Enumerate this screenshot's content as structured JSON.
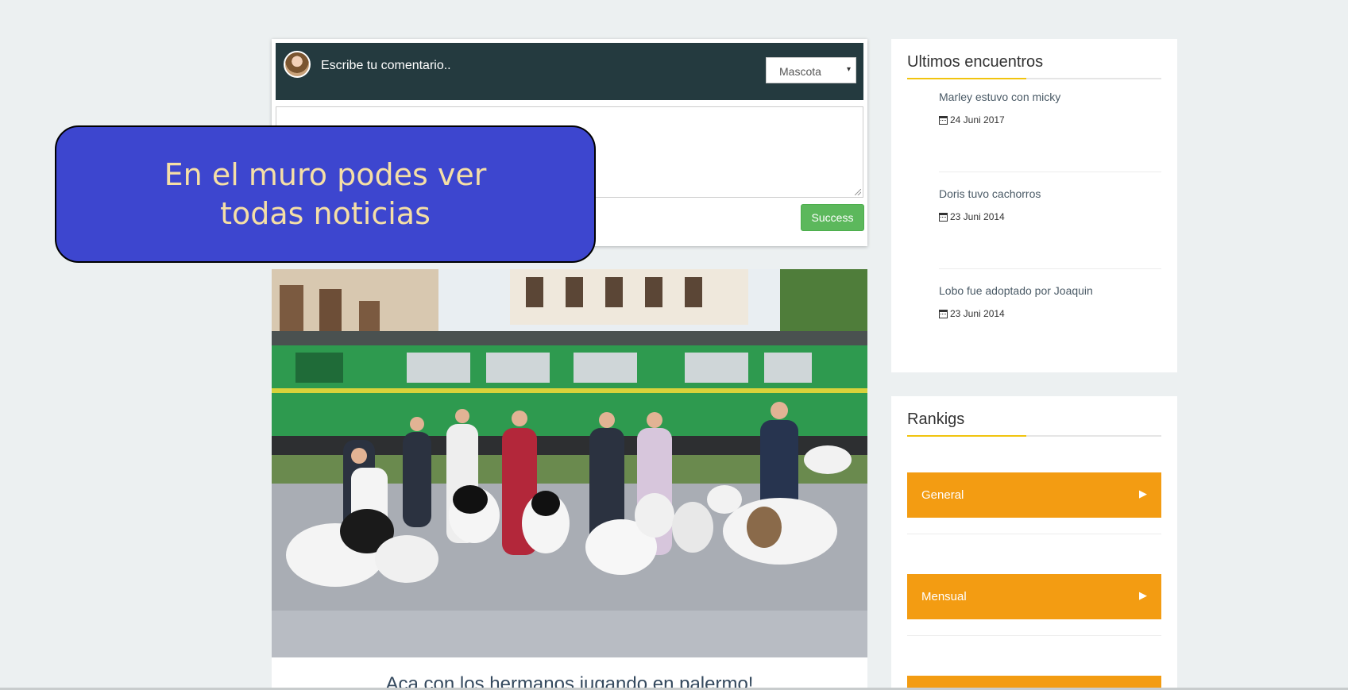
{
  "composer": {
    "title": "Escribe tu comentario..",
    "select_value": "Mascota",
    "textarea_value": "",
    "submit_label": "Success"
  },
  "tooltip": {
    "text": "En el muro podes ver todas noticias"
  },
  "post": {
    "caption": "Aca con los hermanos jugando en palermo!"
  },
  "encuentros": {
    "title": "Ultimos encuentros",
    "items": [
      {
        "title": "Marley estuvo con micky",
        "date": "24 Juni 2017"
      },
      {
        "title": "Doris tuvo cachorros",
        "date": "23 Juni 2014"
      },
      {
        "title": "Lobo fue adoptado por Joaquin",
        "date": "23 Juni 2014"
      }
    ]
  },
  "rankings": {
    "title": "Rankigs",
    "buttons": [
      {
        "label": "General"
      },
      {
        "label": "Mensual"
      }
    ]
  },
  "colors": {
    "composer_bar": "#243a3f",
    "success": "#5cb85c",
    "tooltip_bg": "#3d46cf",
    "tooltip_text": "#f5dfa6",
    "ranking_button": "#f39c12",
    "accent_underline": "#f1c40f"
  },
  "icons": {
    "date": "calendar-icon",
    "ranking_arrow": "play-arrow-icon",
    "select": "caret-down-icon"
  }
}
